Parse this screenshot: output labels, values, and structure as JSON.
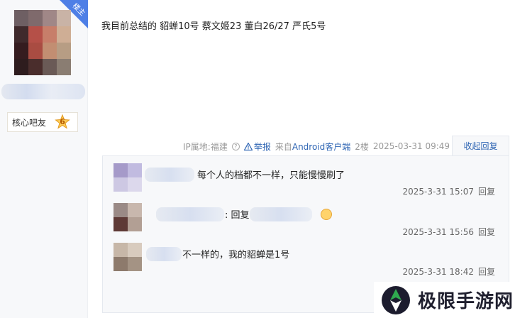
{
  "author": {
    "badge": "楼主",
    "level_label": "核心吧友",
    "level_number": "6"
  },
  "post": {
    "content": "我目前总结的 貂蝉10号 蔡文姬23 董白26/27 严氏5号",
    "meta": {
      "ip": "IP属地:福建",
      "report": "举报",
      "client_prefix": "来自",
      "client": "Android客户端",
      "floor": "2楼",
      "time": "2025-03-31 09:49",
      "collapse": "收起回复"
    }
  },
  "replies": [
    {
      "text": "每个人的档都不一样，只能慢慢刷了",
      "time": "2025-3-31 15:07",
      "reply_label": "回复"
    },
    {
      "prefix": ":",
      "reply_word": "回复",
      "time": "2025-3-31 15:56",
      "reply_label": "回复"
    },
    {
      "text": "不一样的，我的貂蝉是1号",
      "time": "2025-3-31 18:42",
      "reply_label": "回复"
    }
  ],
  "watermark": {
    "text": "极限手游网"
  },
  "colors": {
    "link": "#2d64b3",
    "badge": "#4e7fe6",
    "panel_bg": "#f7f8fa"
  }
}
